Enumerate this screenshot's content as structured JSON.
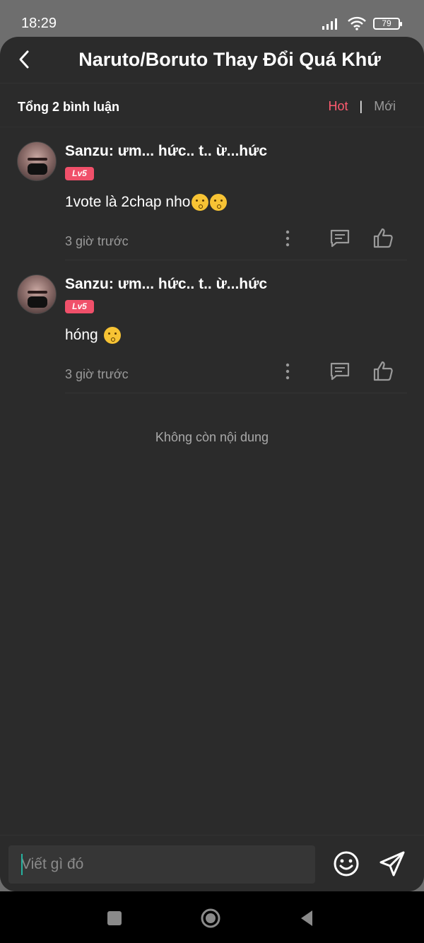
{
  "status_bar": {
    "time": "18:29",
    "battery": "79"
  },
  "header": {
    "title": "Naruto/Boruto Thay Đổi Quá Khứ"
  },
  "sort": {
    "total": "Tổng 2 bình luận",
    "hot": "Hot",
    "separator": "|",
    "new": "Mới"
  },
  "comments": [
    {
      "username": "Sanzu: ưm... hức.. t.. ừ...hức",
      "level": "Lv5",
      "text": "1vote là 2chap nho",
      "emoji_count": 2,
      "time": "3 giờ trước"
    },
    {
      "username": "Sanzu: ưm... hức.. t.. ừ...hức",
      "level": "Lv5",
      "text": "hóng ",
      "emoji_count": 1,
      "time": "3 giờ trước"
    }
  ],
  "end_message": "Không còn nội dung",
  "composer": {
    "placeholder": "Viết gì đó"
  },
  "colors": {
    "accent": "#ff5b6f",
    "background": "#2b2b2b",
    "badge": "#f0506a"
  }
}
